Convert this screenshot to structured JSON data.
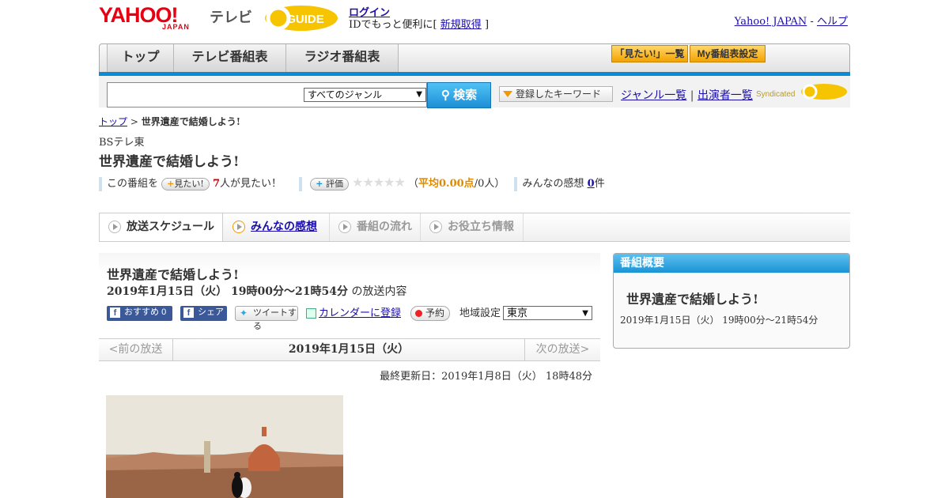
{
  "header": {
    "logo_yahoo": "YAHOO!",
    "logo_japan": "JAPAN",
    "logo_tv": "テレビ",
    "logo_gguide": "GUIDE",
    "login_link": "ログイン",
    "login_sub_text": "IDでもっと便利に[",
    "register_link": "新規取得",
    "login_sub_close": "]",
    "yahoo_japan_link": "Yahoo! JAPAN",
    "separator": "-",
    "help_link": "ヘルプ"
  },
  "nav": {
    "tabs": [
      "トップ",
      "テレビ番組表",
      "ラジオ番組表"
    ],
    "mitai_list": "「見たい!」一覧",
    "my_bangumi": "My番組表設定"
  },
  "search": {
    "genre_select": "すべてのジャンル",
    "search_button": "検索",
    "keyword_button": "登録したキーワード",
    "genre_list": "ジャンル一覧",
    "pipe": "|",
    "performer_list": "出演者一覧",
    "syndicated": "Syndicated"
  },
  "breadcrumb": {
    "top": "トップ",
    "sep": ">",
    "current": "世界遺産で結婚しよう!"
  },
  "program": {
    "channel": "BSテレ東",
    "title": "世界遺産で結婚しよう!",
    "this_program": "この番組を",
    "mitai_button": "見たい!",
    "mitai_count": "7",
    "mitai_suffix": "人が見たい！",
    "hyouka_button": "評価",
    "stars": "★★★★★",
    "rating_open": "（",
    "rating_avg": "平均0.00点",
    "rating_people": "/0人）",
    "kansou_label": "みんなの感想",
    "kansou_count": "0",
    "kansou_suffix": "件"
  },
  "tabs": [
    "放送スケジュール",
    "みんなの感想",
    "番組の流れ",
    "お役立ち情報"
  ],
  "schedule": {
    "title": "世界遺産で結婚しよう!",
    "date": "2019年1月15日（火） 19時00分～21時54分",
    "date_suffix": "の放送内容",
    "osusume": "おすすめ",
    "osusume_count": "0",
    "share": "シェア",
    "tweet": "ツイートする",
    "calendar": "カレンダーに登録",
    "yoyaku": "予約",
    "region_label": "地域設定",
    "region_value": "東京",
    "prev": "<前の放送",
    "current_date": "2019年1月15日（火）",
    "next": "次の放送>",
    "updated": "最終更新日：2019年1月8日（火） 18時48分"
  },
  "sidebar": {
    "header": "番組概要",
    "title": "世界遺産で結婚しよう!",
    "date": "2019年1月15日（火） 19時00分～21時54分"
  },
  "colors": {
    "accent_blue": "#0a8bd6",
    "yahoo_red": "#e60012",
    "orange": "#f39800"
  }
}
